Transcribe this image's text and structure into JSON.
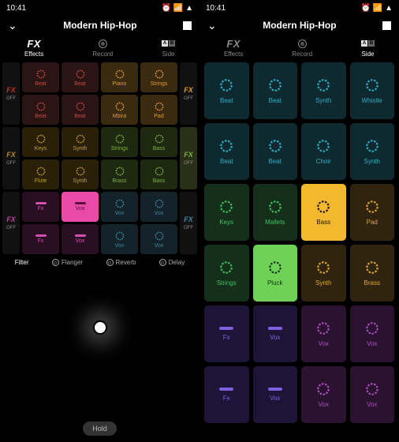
{
  "status": {
    "time": "10:41",
    "icons": [
      "alarm",
      "signal",
      "wifi",
      "battery"
    ]
  },
  "header": {
    "title": "Modern Hip-Hop"
  },
  "tabs": {
    "fx": "FX",
    "effects": "Effects",
    "record": "Record",
    "side": "Side",
    "a": "A",
    "b": "B"
  },
  "fxcol": {
    "label": "FX",
    "off": "OFF"
  },
  "left": {
    "rows": [
      {
        "fxColor": "#c03030",
        "pads": [
          {
            "label": "Beat",
            "bg": "#2a1414",
            "c": "#c94747",
            "shape": "ring"
          },
          {
            "label": "Beat",
            "bg": "#2a1414",
            "c": "#c94747",
            "shape": "ring"
          },
          {
            "label": "Piano",
            "bg": "#3a2a10",
            "c": "#e09a30",
            "shape": "ring"
          },
          {
            "label": "Strings",
            "bg": "#3a2a10",
            "c": "#e09a30",
            "shape": "ring"
          }
        ]
      },
      {
        "fxColor": "#c03030",
        "pads": [
          {
            "label": "Beat",
            "bg": "#2a1414",
            "c": "#c94747",
            "shape": "ring"
          },
          {
            "label": "Beat",
            "bg": "#2a1414",
            "c": "#c94747",
            "shape": "ring"
          },
          {
            "label": "Mbira",
            "bg": "#3a2a10",
            "c": "#e09a30",
            "shape": "ring"
          },
          {
            "label": "Pad",
            "bg": "#3a2a10",
            "c": "#e09a30",
            "shape": "ring"
          }
        ]
      },
      {
        "fxColor": "#b09020",
        "pads": [
          {
            "label": "Keys",
            "bg": "#2a2008",
            "c": "#c0a030",
            "shape": "ring"
          },
          {
            "label": "Synth",
            "bg": "#2a2008",
            "c": "#c0a030",
            "shape": "ring"
          },
          {
            "label": "Strings",
            "bg": "#1e2a10",
            "c": "#7fb040",
            "shape": "ring"
          },
          {
            "label": "Bass",
            "bg": "#1e2a10",
            "c": "#7fb040",
            "shape": "ring"
          }
        ]
      },
      {
        "fxColor": "#b09020",
        "pads": [
          {
            "label": "Flute",
            "bg": "#2a2008",
            "c": "#c0a030",
            "shape": "ring"
          },
          {
            "label": "Synth",
            "bg": "#2a2008",
            "c": "#c0a030",
            "shape": "ring"
          },
          {
            "label": "Brass",
            "bg": "#1e2a10",
            "c": "#7fb040",
            "shape": "ring"
          },
          {
            "label": "Bass",
            "bg": "#1e2a10",
            "c": "#7fb040",
            "shape": "ring"
          }
        ]
      },
      {
        "fxColor": "#c040a0",
        "pads": [
          {
            "label": "Fx",
            "bg": "#2a0e22",
            "c": "#d050b0",
            "shape": "dash"
          },
          {
            "label": "Vox",
            "bg": "#e84aa8",
            "c": "#5a1040",
            "shape": "dash",
            "active": true
          },
          {
            "label": "Vox",
            "bg": "#14222a",
            "c": "#3a8aa0",
            "shape": "ring"
          },
          {
            "label": "Vox",
            "bg": "#14222a",
            "c": "#3a8aa0",
            "shape": "ring"
          }
        ]
      },
      {
        "fxColor": "#c040a0",
        "pads": [
          {
            "label": "Fx",
            "bg": "#2a0e22",
            "c": "#d050b0",
            "shape": "dash"
          },
          {
            "label": "Vox",
            "bg": "#2a0e22",
            "c": "#d050b0",
            "shape": "dash"
          },
          {
            "label": "Vox",
            "bg": "#14222a",
            "c": "#3a8aa0",
            "shape": "ring"
          },
          {
            "label": "Vox",
            "bg": "#14222a",
            "c": "#3a8aa0",
            "shape": "ring"
          }
        ]
      }
    ],
    "rfx": [
      {
        "c": "#e09a30"
      },
      {
        "c": "#e09a30"
      },
      {
        "c": "#7fb040",
        "active": true
      },
      {
        "c": "#7fb040"
      },
      {
        "c": "#3a8aa0"
      },
      {
        "c": "#3a8aa0"
      }
    ]
  },
  "fxTabs": [
    {
      "label": "Filter",
      "active": true
    },
    {
      "label": "Flanger"
    },
    {
      "label": "Reverb"
    },
    {
      "label": "Delay"
    }
  ],
  "hold": "Hold",
  "right": {
    "rows": [
      [
        {
          "label": "Beat",
          "bg": "#0e2a30",
          "c": "#2db0c8",
          "shape": "ring"
        },
        {
          "label": "Beat",
          "bg": "#0e2a30",
          "c": "#2db0c8",
          "shape": "ring"
        },
        {
          "label": "Synth",
          "bg": "#0e2a30",
          "c": "#2db0c8",
          "shape": "ring"
        },
        {
          "label": "Whistle",
          "bg": "#0e2a30",
          "c": "#2db0c8",
          "shape": "ring"
        }
      ],
      [
        {
          "label": "Beat",
          "bg": "#0e2a30",
          "c": "#2db0c8",
          "shape": "ring"
        },
        {
          "label": "Beat",
          "bg": "#0e2a30",
          "c": "#2db0c8",
          "shape": "ring"
        },
        {
          "label": "Choir",
          "bg": "#0e2a30",
          "c": "#2db0c8",
          "shape": "ring"
        },
        {
          "label": "Synth",
          "bg": "#0e2a30",
          "c": "#2db0c8",
          "shape": "ring"
        }
      ],
      [
        {
          "label": "Keys",
          "bg": "#14301a",
          "c": "#45c060",
          "shape": "ring"
        },
        {
          "label": "Mallets",
          "bg": "#14301a",
          "c": "#45c060",
          "shape": "ring"
        },
        {
          "label": "Bass",
          "bg": "#f2b82e",
          "c": "#1a1000",
          "shape": "ring",
          "active": true
        },
        {
          "label": "Pad",
          "bg": "#30240e",
          "c": "#e0a830",
          "shape": "ring"
        }
      ],
      [
        {
          "label": "Strings",
          "bg": "#14301a",
          "c": "#45c060",
          "shape": "ring"
        },
        {
          "label": "Pluck",
          "bg": "#6fd256",
          "c": "#0e3014",
          "shape": "ring",
          "active": true
        },
        {
          "label": "Synth",
          "bg": "#30240e",
          "c": "#e0a830",
          "shape": "ring"
        },
        {
          "label": "Brass",
          "bg": "#30240e",
          "c": "#e0a830",
          "shape": "ring"
        }
      ],
      [
        {
          "label": "Fx",
          "bg": "#1e1438",
          "c": "#8060e0",
          "shape": "dash"
        },
        {
          "label": "Vox",
          "bg": "#1e1438",
          "c": "#8060e0",
          "shape": "dash"
        },
        {
          "label": "Vox",
          "bg": "#2a1230",
          "c": "#b050c0",
          "shape": "ring"
        },
        {
          "label": "Vox",
          "bg": "#2a1230",
          "c": "#b050c0",
          "shape": "ring"
        }
      ],
      [
        {
          "label": "Fx",
          "bg": "#1e1438",
          "c": "#8060e0",
          "shape": "dash"
        },
        {
          "label": "Vox",
          "bg": "#1e1438",
          "c": "#8060e0",
          "shape": "dash"
        },
        {
          "label": "Vox",
          "bg": "#2a1230",
          "c": "#b050c0",
          "shape": "ring"
        },
        {
          "label": "Vox",
          "bg": "#2a1230",
          "c": "#b050c0",
          "shape": "ring"
        }
      ]
    ]
  }
}
